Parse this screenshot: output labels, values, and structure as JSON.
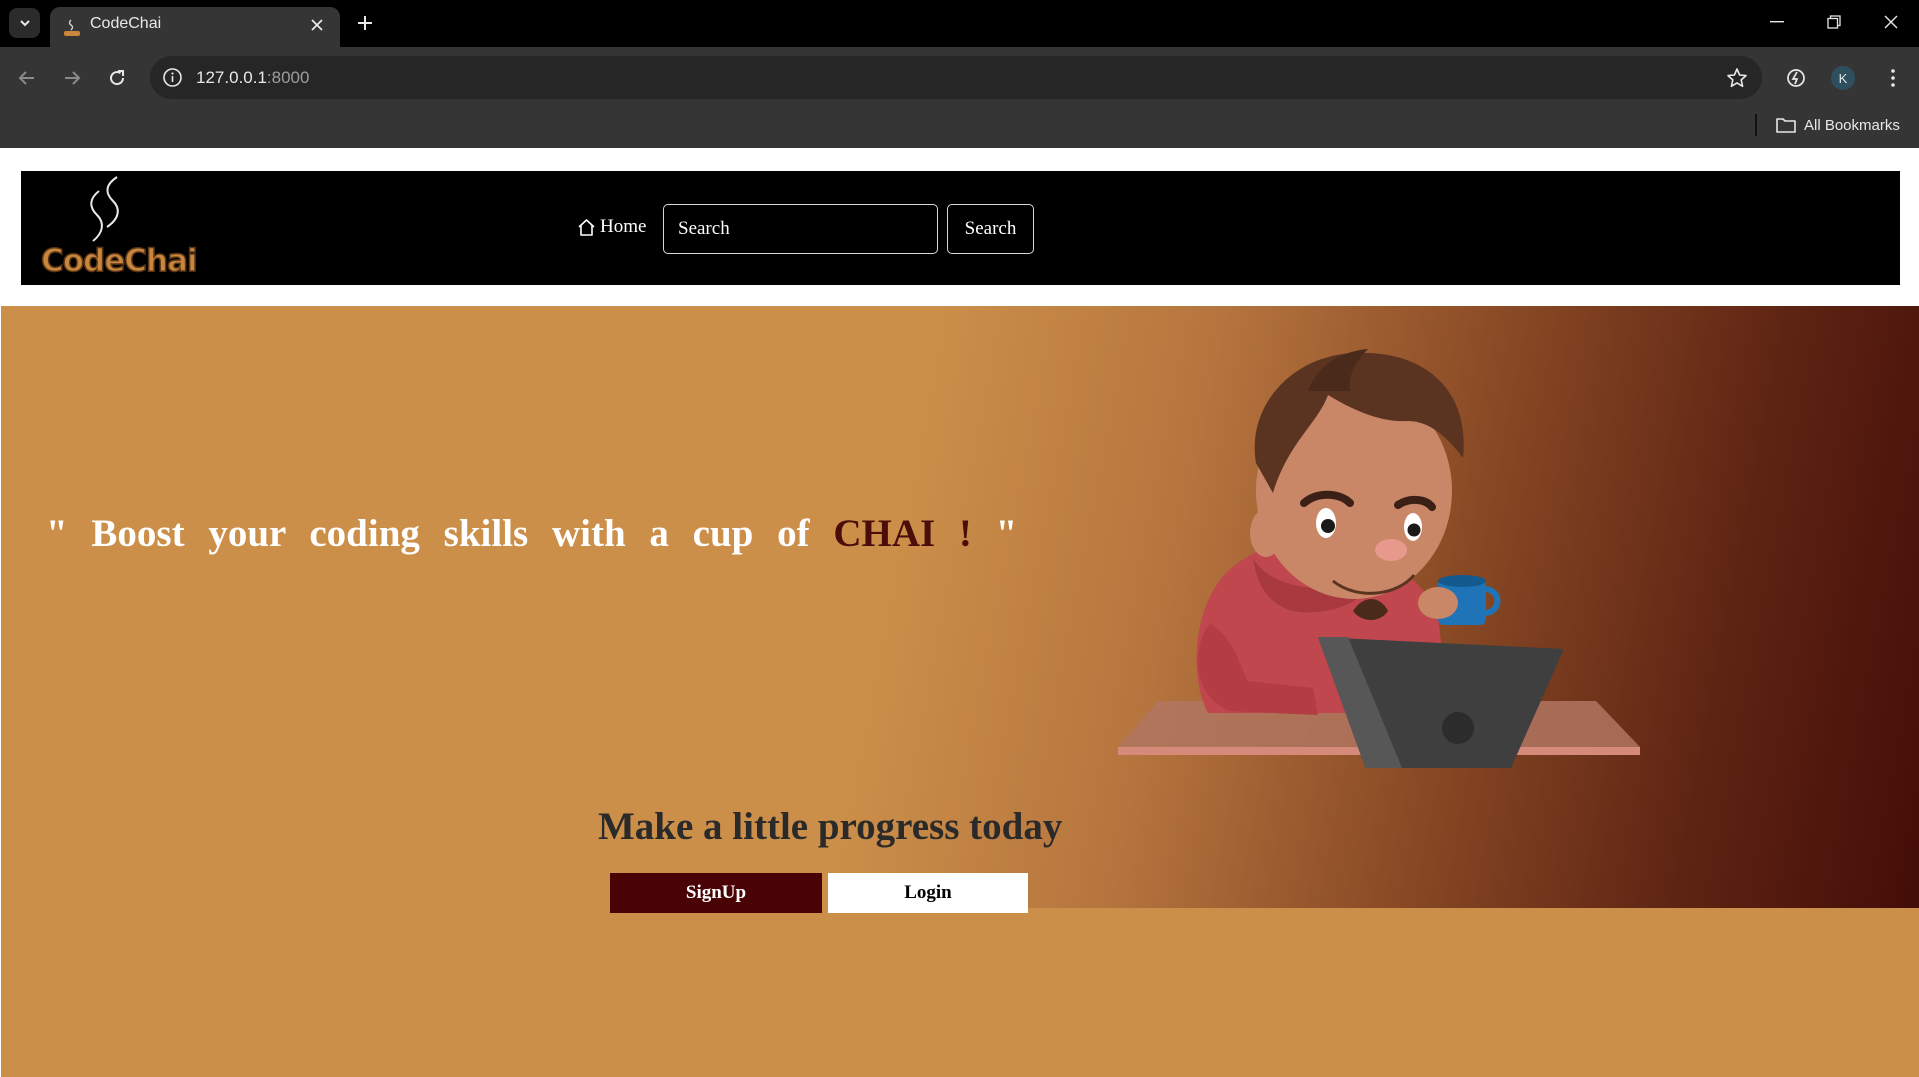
{
  "browser": {
    "tab": {
      "title": "CodeChai",
      "favicon": "codechai-favicon"
    },
    "address": {
      "host": "127.0.0.1",
      "port": ":8000"
    },
    "bookmarks": {
      "all_label": "All Bookmarks"
    },
    "profile_initial": "K"
  },
  "navbar": {
    "logo_text": "CodeChai",
    "home_label": "Home",
    "search_placeholder": "Search",
    "search_button": "Search"
  },
  "hero": {
    "tagline_pre": "\" Boost your coding skills with a cup of ",
    "tagline_highlight": "CHAI ! ",
    "tagline_post": "\"",
    "subtitle": "Make a little progress today",
    "signup_label": "SignUp",
    "login_label": "Login"
  },
  "colors": {
    "hero_bg": "#cc8f49",
    "highlight": "#4a0d0a",
    "signup_bg": "#4a0304",
    "navbar_bg": "#000000"
  }
}
